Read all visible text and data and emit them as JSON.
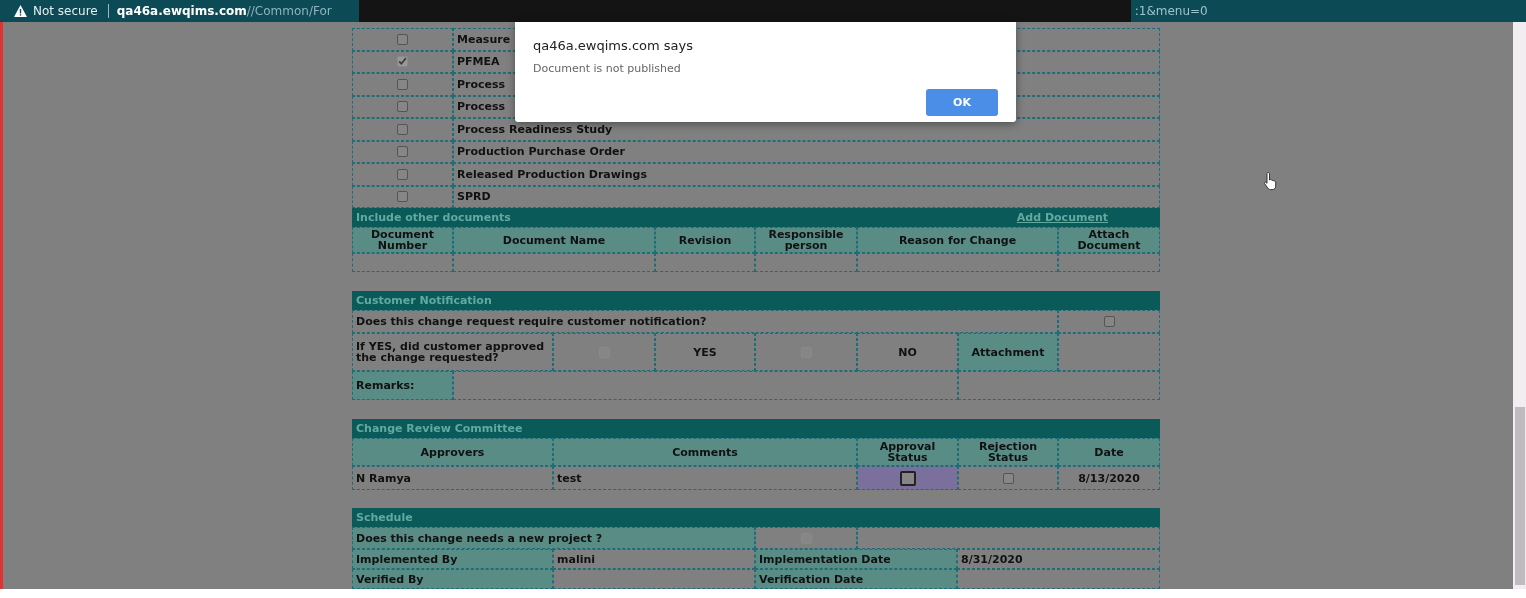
{
  "browser_bar": {
    "security": "Not secure",
    "url_start": "**qa46a.ewqims.com**//Common/For",
    "url_end": ":1&menu=0"
  },
  "documents": [
    {
      "name": "Measure",
      "checked": false,
      "disabled": false
    },
    {
      "name": "PFMEA",
      "checked": true,
      "disabled": true
    },
    {
      "name": "Process",
      "checked": false,
      "disabled": false
    },
    {
      "name": "Process",
      "checked": false,
      "disabled": false
    },
    {
      "name": "Process Readiness Study",
      "checked": false,
      "disabled": false
    },
    {
      "name": "Production Purchase Order",
      "checked": false,
      "disabled": false
    },
    {
      "name": "Released Production Drawings",
      "checked": false,
      "disabled": false
    },
    {
      "name": "SPRD",
      "checked": false,
      "disabled": false
    }
  ],
  "other_documents": {
    "title": "Include other documents",
    "link": "Add Document",
    "columns": [
      "Document Number",
      "Document Name",
      "Revision",
      "Responsible person",
      "Reason for Change",
      "Attach Document"
    ]
  },
  "customer_notification": {
    "title": "Customer Notification",
    "question": "Does this change request require customer notification?",
    "question_checked": false,
    "approval_question": "If YES, did customer approved the change requested?",
    "options": [
      {
        "label": "YES",
        "checked": false,
        "disabled": true
      },
      {
        "label": "NO",
        "checked": false,
        "disabled": true
      }
    ],
    "attachment_label": "Attachment",
    "remarks_label": "Remarks:"
  },
  "review_committee": {
    "title": "Change Review Committee",
    "columns": [
      "Approvers",
      "Comments",
      "Approval Status",
      "Rejection Status",
      "Date"
    ],
    "rows": [
      {
        "approver": "N Ramya",
        "comment": "test",
        "approved": false,
        "approval_focused": true,
        "rejected": false,
        "date": "8/13/2020"
      }
    ]
  },
  "schedule": {
    "title": "Schedule",
    "project_question": "Does this change needs a new project ?",
    "project_checked": false,
    "project_disabled": true,
    "fields": [
      {
        "label": "Implemented By",
        "value": "malini"
      },
      {
        "label": "Implementation Date",
        "value": "8/31/2020"
      },
      {
        "label": "Verified By"
      },
      {
        "label": "Verification Date"
      }
    ]
  },
  "dialog": {
    "title": "qa46a.ewqims.com says",
    "message": "Document is not published",
    "button": "OK"
  }
}
